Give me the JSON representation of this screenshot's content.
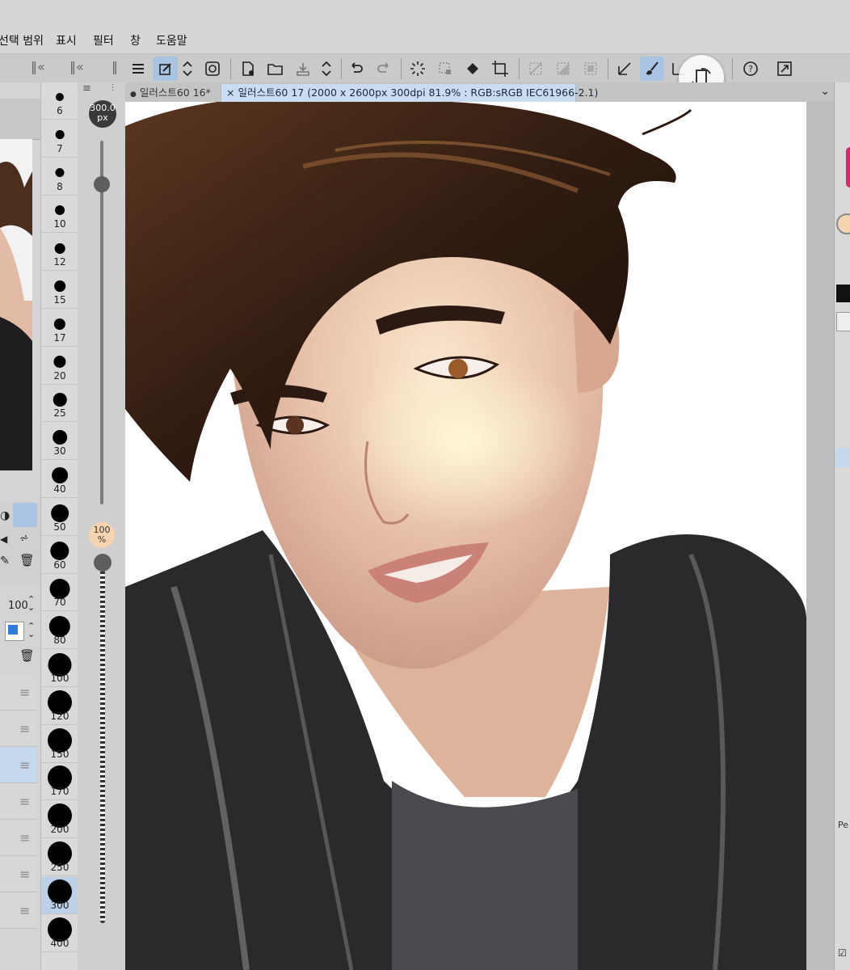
{
  "menu": {
    "items": [
      "선택 범위",
      "표시",
      "필터",
      "창",
      "도움말"
    ]
  },
  "tabs": [
    {
      "label": "일러스트60 16*",
      "active": false
    },
    {
      "label": "일러스트60 17 (2000 x 2600px 300dpi 81.9% : RGB:sRGB IEC61966-2.1)",
      "active": true
    }
  ],
  "brush_sizes": {
    "values": [
      "6",
      "7",
      "8",
      "10",
      "12",
      "15",
      "17",
      "20",
      "25",
      "30",
      "40",
      "50",
      "60",
      "70",
      "80",
      "100",
      "120",
      "150",
      "170",
      "200",
      "250",
      "300",
      "400"
    ],
    "selected": "300"
  },
  "size_slider": {
    "value": "300.0",
    "unit": "px",
    "level": 0.12
  },
  "opacity_slider": {
    "value": "100",
    "unit": "%",
    "level": 0.0
  },
  "layer_panel": {
    "opacity_value": "100"
  },
  "right_panel": {
    "label_partial": "Pe"
  },
  "colors": {
    "accent": "#a9c3e3",
    "tab_active": "#c9dcf2",
    "opacity_bubble": "#f7d4b0",
    "toolbar": "#cacaca"
  }
}
